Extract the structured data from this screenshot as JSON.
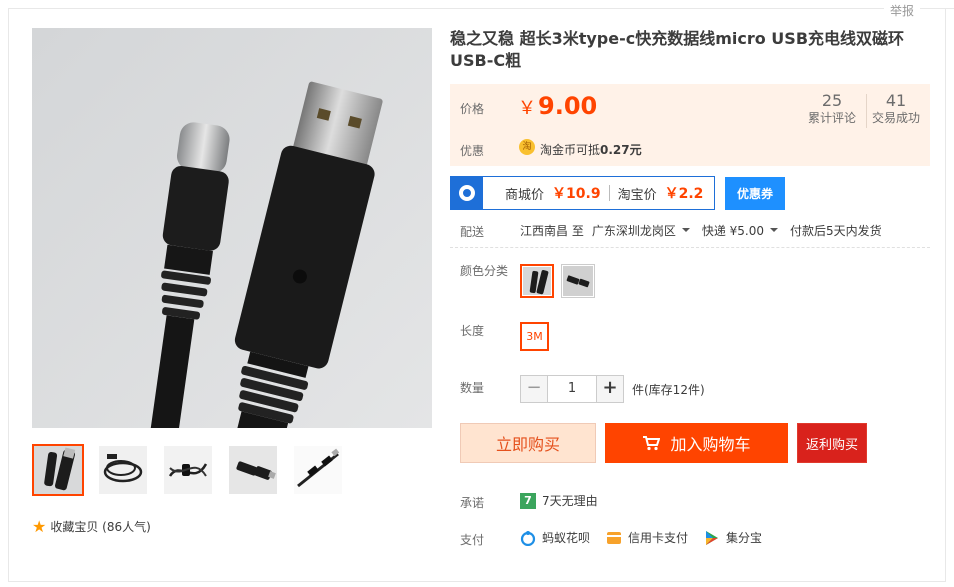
{
  "report_label": "举报",
  "product": {
    "title": "稳之又稳 超长3米type-c快充数据线micro USB充电线双磁环USB-C粗"
  },
  "price_panel": {
    "price_label": "价格",
    "currency": "￥",
    "price": "9.00",
    "reviews_count": "25",
    "reviews_label": "累计评论",
    "sales_count": "41",
    "sales_label": "交易成功",
    "promo_label": "优惠",
    "coin_icon_text": "淘",
    "promo_prefix": "淘金币可抵",
    "promo_value": "0.27元"
  },
  "coupon": {
    "mall_label": "商城价",
    "mall_price": "￥10.9",
    "taobao_label": "淘宝价",
    "taobao_price": "￥2.2",
    "button_label": "优惠券"
  },
  "shipping": {
    "label": "配送",
    "from": "江西南昌 至",
    "to": "广东深圳龙岗区",
    "express": "快递 ¥5.00",
    "ship_time": "付款后5天内发货"
  },
  "sku": {
    "color_label": "颜色分类",
    "length_label": "长度",
    "length_option": "3M"
  },
  "quantity": {
    "label": "数量",
    "minus": "−",
    "value": "1",
    "plus": "+",
    "stock": "件(库存12件)"
  },
  "actions": {
    "buy_now": "立即购买",
    "add_to_cart": "加入购物车",
    "rebate": "返利购买"
  },
  "promise": {
    "label": "承诺",
    "badge": "7",
    "text": "7天无理由"
  },
  "payment": {
    "label": "支付",
    "methods": [
      "蚂蚁花呗",
      "信用卡支付",
      "集分宝"
    ]
  },
  "favorite": {
    "text": "收藏宝贝 (86人气)"
  },
  "colors": {
    "accent": "#ff4400",
    "panel_bg": "#fff2e8",
    "coupon_blue": "#1e6fd8"
  }
}
